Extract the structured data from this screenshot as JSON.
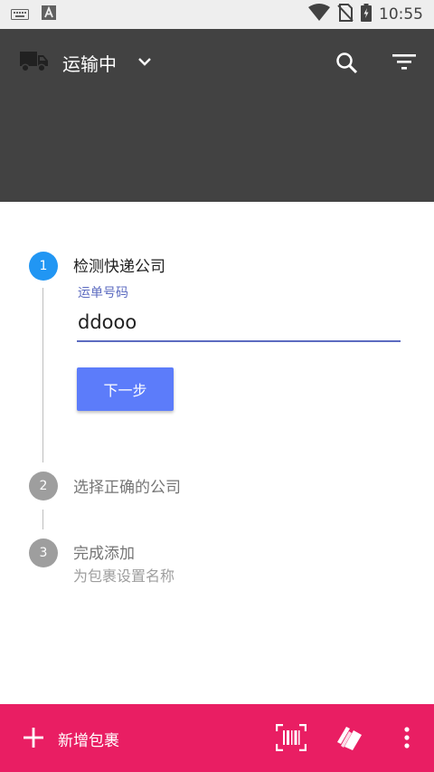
{
  "status_bar": {
    "time": "10:55",
    "icons": [
      "keyboard-icon",
      "a-notification-icon",
      "wifi-icon",
      "no-sim-icon",
      "battery-charging-icon"
    ]
  },
  "app_bar": {
    "title": "运输中",
    "icons": [
      "truck-icon",
      "chevron-down-icon",
      "search-icon",
      "filter-icon"
    ],
    "background": "#424242"
  },
  "stepper": {
    "steps": [
      {
        "number": "1",
        "title": "检测快递公司",
        "state": "active"
      },
      {
        "number": "2",
        "title": "选择正确的公司",
        "state": "inactive"
      },
      {
        "number": "3",
        "title": "完成添加",
        "subtitle": "为包裹设置名称",
        "state": "inactive"
      }
    ],
    "tracking_field": {
      "label": "运单号码",
      "value": "ddooo"
    },
    "next_button": "下一步",
    "active_color": "#2196f3"
  },
  "bottom_bar": {
    "add_label": "新增包裹",
    "icons": [
      "plus-icon",
      "barcode-scan-icon",
      "tag-icon",
      "more-vert-icon"
    ],
    "background": "#e91e63"
  }
}
